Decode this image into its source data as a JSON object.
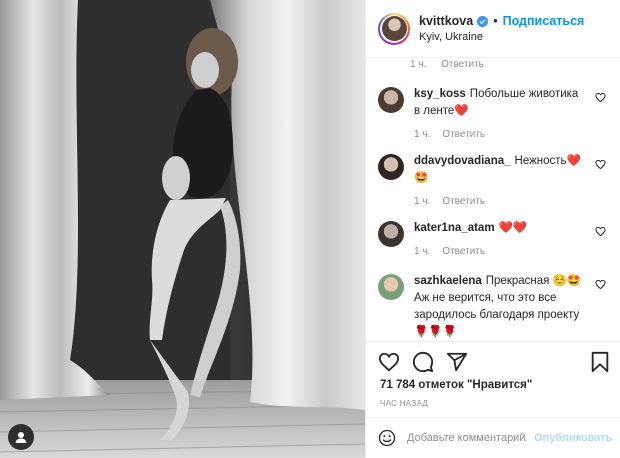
{
  "post": {
    "author": {
      "username": "kvittkova",
      "location": "Kyiv, Ukraine",
      "follow_label": "Подписаться",
      "separator": "•"
    },
    "caption_meta": {
      "time": "1 ч.",
      "reply": "Ответить"
    },
    "comments": [
      {
        "username": "ksy_koss",
        "text": "Побольше животика в ленте❤️",
        "time": "1 ч.",
        "reply": "Ответить"
      },
      {
        "username": "ddavydovadiana_",
        "text": "Нежность❤️🤩",
        "time": "1 ч.",
        "reply": "Ответить"
      },
      {
        "username": "kater1na_atam",
        "text": "❤️❤️",
        "time": "1 ч.",
        "reply": "Ответить"
      },
      {
        "username": "sazhkaelena",
        "text": "Прекрасная ☺️🤩 Аж не верится, что это все зародилось благодаря проекту 🌹🌹🌹",
        "time": "",
        "reply": ""
      }
    ],
    "likes_text": "71 784 отметок \"Нравится\"",
    "timestamp": "ЧАС НАЗАД",
    "comment_input": {
      "placeholder": "Добавьте комментарий...",
      "publish_label": "Опубликовать"
    }
  },
  "colors": {
    "accent": "#0095f6",
    "muted": "#8e8e8e",
    "publish_disabled": "#b3dbff",
    "heart": "#ed4956"
  },
  "icons": [
    "verified-icon",
    "heart-icon",
    "comment-icon",
    "share-icon",
    "bookmark-icon",
    "emoji-icon",
    "tag-icon"
  ]
}
